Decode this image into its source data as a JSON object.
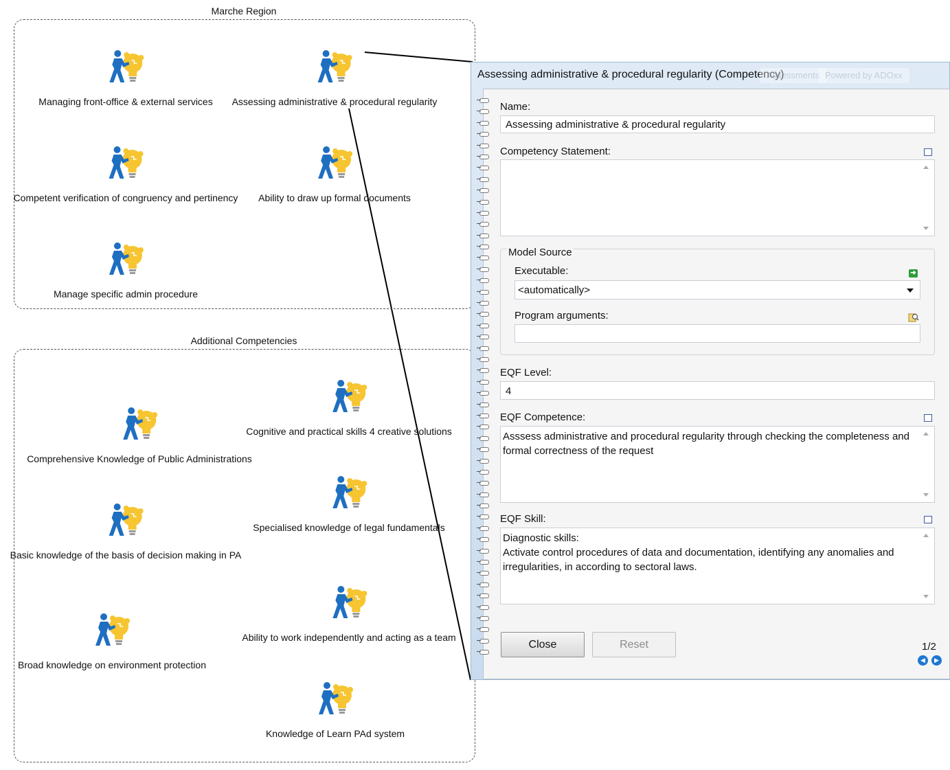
{
  "groups": [
    {
      "title": "Marche Region",
      "items": [
        "Managing front-office & external services",
        "Assessing administrative & procedural regularity",
        "Competent verification of congruency and pertinency",
        "Ability to draw up formal documents",
        "Manage specific admin procedure"
      ]
    },
    {
      "title": "Additional Competencies",
      "items": [
        "Cognitive and practical skills 4 creative solutions",
        "Comprehensive Knowledge of Public Administrations",
        "Specialised knowledge of legal fundamentals",
        "Basic knowledge of the basis of decision making in PA",
        "Ability to work independently and acting as a team",
        "Broad knowledge on environment protection",
        "Knowledge of Learn PAd system"
      ]
    }
  ],
  "icon": "person-pushing-lightbulb-puzzle-icon",
  "colors": {
    "person": "#1f6fc1",
    "bulb": "#f6c531",
    "dialog_bg": "#dfeaf6"
  },
  "dialog": {
    "title": "Assessing administrative & procedural regularity (Competency)",
    "ghost_tabs": [
      "Assessments",
      "Powered by ADOxx"
    ],
    "fields": {
      "name_label": "Name:",
      "name_value": "Assessing administrative & procedural regularity",
      "statement_label": "Competency Statement:",
      "statement_value": "",
      "model_source_label": "Model Source",
      "executable_label": "Executable:",
      "executable_value": "<automatically>",
      "program_args_label": "Program arguments:",
      "program_args_value": "",
      "eqf_level_label": "EQF Level:",
      "eqf_level_value": "4",
      "eqf_competence_label": "EQF Competence:",
      "eqf_competence_value": "Asssess administrative and procedural regularity through checking the completeness and formal correctness of the request",
      "eqf_skill_label": "EQF Skill:",
      "eqf_skill_line1": "Diagnostic skills:",
      "eqf_skill_line2": "Activate control procedures of data and documentation, identifying any anomalies and irregularities, in according to sectoral laws."
    },
    "buttons": {
      "close": "Close",
      "reset": "Reset"
    },
    "pager": "1/2"
  }
}
